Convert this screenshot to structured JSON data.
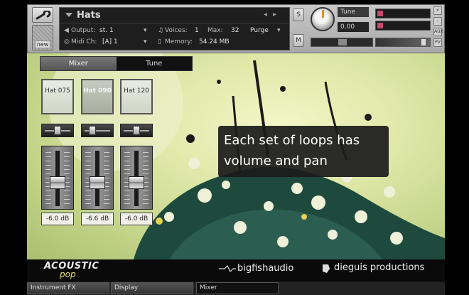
{
  "header": {
    "instrument_name": "Hats",
    "output_label": "Output:",
    "output_value": "st. 1",
    "midi_label": "Midi Ch:",
    "midi_value": "[A]  1",
    "voices_label": "Voices:",
    "voices_value": "1",
    "max_label": "Max:",
    "max_value": "32",
    "purge_label": "Purge",
    "memory_label": "Memory:",
    "memory_value": "54.24 MB",
    "new_label": "new",
    "solo_label": "S",
    "mute_label": "M",
    "tune_label": "Tune",
    "tune_value": "0.00",
    "side_aux_label": "AUX",
    "side_pv_label": "PV"
  },
  "tabs": {
    "mixer": "Mixer",
    "tune": "Tune"
  },
  "channels": [
    {
      "name": "Hat 075",
      "db": "-6.0 dB",
      "active": false
    },
    {
      "name": "Hat 090",
      "db": "-6.6 dB",
      "active": true
    },
    {
      "name": "Hat 120",
      "db": "-6.0 dB",
      "active": false
    }
  ],
  "tooltip": {
    "line1": "Each set of loops has",
    "line2": "volume and pan"
  },
  "footer": {
    "logo_acoustic": "ACOUSTIC",
    "logo_pop": "pop",
    "bigfish": "bigfishaudio",
    "dieguis": "dieguis productions"
  },
  "bottom_tabs": {
    "fx": "Instrument FX",
    "display": "Display",
    "mixer": "Mixer"
  },
  "colors": {
    "accent_orange": "#e89020",
    "artwork_light": "#f4f6c8",
    "artwork_mid": "#c4d48a"
  }
}
